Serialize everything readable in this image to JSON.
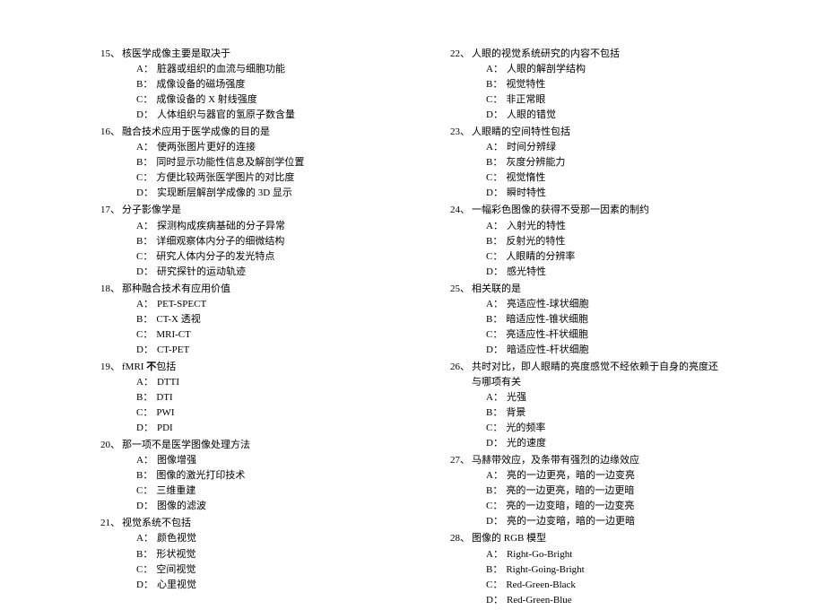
{
  "left": [
    {
      "num": "15、",
      "text": "核医学成像主要是取决于",
      "opts": [
        [
          "A：",
          "脏器或组织的血流与细胞功能"
        ],
        [
          "B：",
          "成像设备的磁场强度"
        ],
        [
          "C：",
          "成像设备的 X 射线强度"
        ],
        [
          "D：",
          "人体组织与器官的氢原子数含量"
        ]
      ]
    },
    {
      "num": "16、",
      "text": "融合技术应用于医学成像的目的是",
      "opts": [
        [
          "A：",
          "使两张图片更好的连接"
        ],
        [
          "B：",
          "同时显示功能性信息及解剖学位置"
        ],
        [
          "C：",
          "方便比较两张医学图片的对比度"
        ],
        [
          "D：",
          "实现断层解剖学成像的 3D 显示"
        ]
      ]
    },
    {
      "num": "17、",
      "text": "分子影像学是",
      "opts": [
        [
          "A：",
          "探测构成疾病基础的分子异常"
        ],
        [
          "B：",
          "详细观察体内分子的细微结构"
        ],
        [
          "C：",
          "研究人体内分子的发光特点"
        ],
        [
          "D：",
          "研究探针的运动轨迹"
        ]
      ]
    },
    {
      "num": "18、",
      "text": "那种融合技术有应用价值",
      "opts": [
        [
          "A：",
          "PET-SPECT"
        ],
        [
          "B：",
          "CT-X 透视"
        ],
        [
          "C：",
          "MRI-CT"
        ],
        [
          "D：",
          "CT-PET"
        ]
      ]
    },
    {
      "num": "19、",
      "text_html": "fMRI <span class=\"bold\">不</span>包括",
      "opts": [
        [
          "A：",
          "DTTI"
        ],
        [
          "B：",
          "DTI"
        ],
        [
          "C：",
          "PWI"
        ],
        [
          "D：",
          "PDI"
        ]
      ]
    },
    {
      "num": "20、",
      "text": "那一项不是医学图像处理方法",
      "opts": [
        [
          "A：",
          "图像增强"
        ],
        [
          "B：",
          "图像的激光打印技术"
        ],
        [
          "C：",
          "三维重建"
        ],
        [
          "D：",
          "图像的滤波"
        ]
      ]
    },
    {
      "num": "21、",
      "text": "视觉系统不包括",
      "opts": [
        [
          "A：",
          "颜色视觉"
        ],
        [
          "B：",
          "形状视觉"
        ],
        [
          "C：",
          "空间视觉"
        ],
        [
          "D：",
          "心里视觉"
        ]
      ]
    }
  ],
  "right": [
    {
      "num": "22、",
      "text": "人眼的视觉系统研究的内容不包括",
      "opts": [
        [
          "A：",
          "人眼的解剖学结构"
        ],
        [
          "B：",
          "视觉特性"
        ],
        [
          "C：",
          "非正常眼"
        ],
        [
          "D：",
          "人眼的错觉"
        ]
      ]
    },
    {
      "num": "23、",
      "text": "人眼睛的空间特性包括",
      "opts": [
        [
          "A：",
          "时间分辨绿"
        ],
        [
          "B：",
          "灰度分辨能力"
        ],
        [
          "C：",
          "视觉惰性"
        ],
        [
          "D：",
          "瞬时特性"
        ]
      ]
    },
    {
      "num": "24、",
      "text": "一幅彩色图像的获得不受那一因素的制约",
      "opts": [
        [
          "A：",
          "入射光的特性"
        ],
        [
          "B：",
          "反射光的特性"
        ],
        [
          "C：",
          "人眼睛的分辨率"
        ],
        [
          "D：",
          "感光特性"
        ]
      ]
    },
    {
      "num": "25、",
      "text": "相关联的是",
      "opts": [
        [
          "A：",
          "亮适应性-球状细胞"
        ],
        [
          "B：",
          "暗适应性-锥状细胞"
        ],
        [
          "C：",
          "亮适应性-杆状细胞"
        ],
        [
          "D：",
          "暗适应性-杆状细胞"
        ]
      ]
    },
    {
      "num": "26、",
      "text": "共时对比，即人眼睛的亮度感觉不经依赖于自身的亮度还与哪项有关",
      "opts": [
        [
          "A：",
          "光强"
        ],
        [
          "B：",
          "背景"
        ],
        [
          "C：",
          "光的频率"
        ],
        [
          "D：",
          "光的速度"
        ]
      ]
    },
    {
      "num": "27、",
      "text": "马赫带效应，及条带有强烈的边缘效应",
      "opts": [
        [
          "A：",
          "亮的一边更亮，暗的一边变亮"
        ],
        [
          "B：",
          "亮的一边更亮，暗的一边更暗"
        ],
        [
          "C：",
          "亮的一边变暗，暗的一边变亮"
        ],
        [
          "D：",
          "亮的一边变暗，暗的一边更暗"
        ]
      ]
    },
    {
      "num": "28、",
      "text": "图像的 RGB 模型",
      "opts": [
        [
          "A：",
          "Right-Go-Bright"
        ],
        [
          "B：",
          "Right-Going-Bright"
        ],
        [
          "C：",
          "Red-Green-Black"
        ],
        [
          "D：",
          "Red-Green-Blue"
        ]
      ]
    }
  ]
}
